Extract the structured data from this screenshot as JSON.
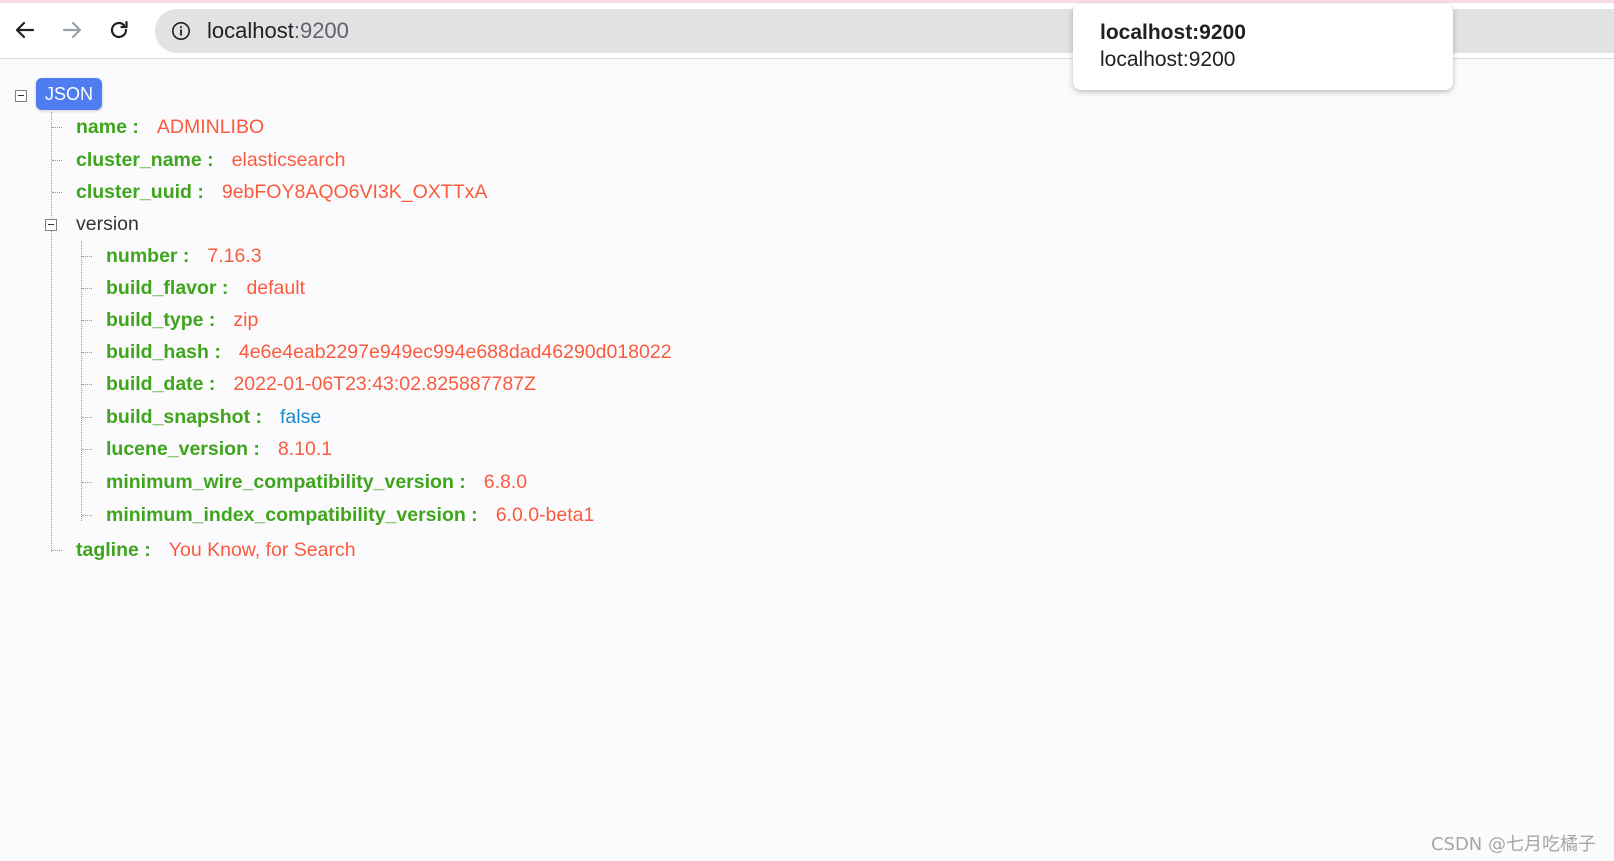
{
  "browser": {
    "url_host": "localhost",
    "url_port": ":9200",
    "popup_title": "localhost:9200",
    "popup_subtitle": "localhost:9200"
  },
  "tree": {
    "root_label": "JSON",
    "fields": [
      {
        "key": "name :",
        "value": "ADMINLIBO"
      },
      {
        "key": "cluster_name :",
        "value": "elasticsearch"
      },
      {
        "key": "cluster_uuid :",
        "value": "9ebFOY8AQO6VI3K_OXTTxA"
      }
    ],
    "version_label": "version",
    "version_fields": [
      {
        "key": "number :",
        "value": "7.16.3"
      },
      {
        "key": "build_flavor :",
        "value": "default"
      },
      {
        "key": "build_type :",
        "value": "zip"
      },
      {
        "key": "build_hash :",
        "value": "4e6e4eab2297e949ec994e688dad46290d018022"
      },
      {
        "key": "build_date :",
        "value": "2022-01-06T23:43:02.825887787Z"
      },
      {
        "key": "build_snapshot :",
        "value": "false"
      },
      {
        "key": "lucene_version :",
        "value": "8.10.1"
      },
      {
        "key": "minimum_wire_compatibility_version :",
        "value": "6.8.0"
      },
      {
        "key": "minimum_index_compatibility_version :",
        "value": "6.0.0-beta1"
      }
    ],
    "tagline": {
      "key": "tagline :",
      "value": "You Know, for Search"
    }
  },
  "watermark": "CSDN @七月吃橘子",
  "colors": {
    "key": "#3fa51c",
    "string_value": "#fa5b3c",
    "boolean_value": "#1a8acb",
    "badge": "#4f7cf0"
  }
}
